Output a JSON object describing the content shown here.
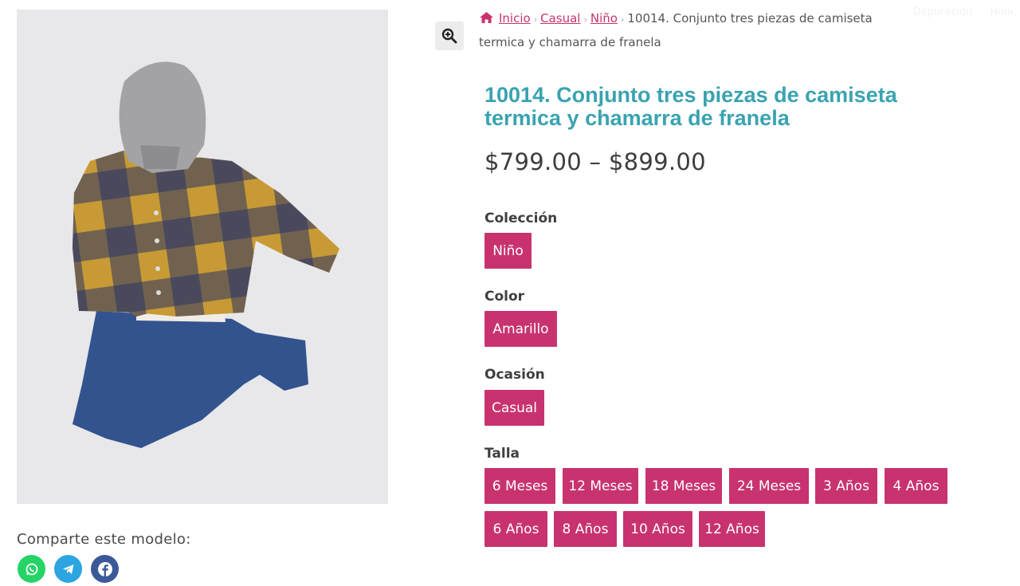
{
  "header": {
    "top_links": [
      "Depuración",
      "Hola,"
    ]
  },
  "breadcrumb": {
    "home": "Inicio",
    "category": "Casual",
    "subcategory": "Niño",
    "current": "10014. Conjunto tres piezas de camiseta termica y chamarra de franela",
    "separator": "›"
  },
  "product": {
    "title": "10014. Conjunto tres piezas de camiseta termica y chamarra de franela",
    "price_range": "$799.00 – $899.00",
    "image_alt": "Conjunto de niño: chamarra de franela a cuadros amarilla y azul con capucha gris y pantalón de mezclilla"
  },
  "attributes": {
    "coleccion": {
      "label": "Colección",
      "values": [
        "Niño"
      ]
    },
    "color": {
      "label": "Color",
      "values": [
        "Amarillo"
      ]
    },
    "ocasion": {
      "label": "Ocasión",
      "values": [
        "Casual"
      ]
    },
    "talla": {
      "label": "Talla",
      "values": [
        "6 Meses",
        "12 Meses",
        "18 Meses",
        "24 Meses",
        "3 Años",
        "4 Años",
        "6 Años",
        "8 Años",
        "10 Años",
        "12 Años"
      ]
    }
  },
  "share": {
    "label": "Comparte este modelo:",
    "buttons": [
      {
        "network": "whatsapp",
        "icon": "whatsapp-icon",
        "color": "#25d366"
      },
      {
        "network": "telegram",
        "icon": "telegram-icon",
        "color": "#2ca5e0"
      },
      {
        "network": "facebook",
        "icon": "facebook-icon",
        "color": "#3b5998"
      }
    ]
  },
  "colors": {
    "accent": "#c8336f",
    "title": "#3aa3b0"
  }
}
